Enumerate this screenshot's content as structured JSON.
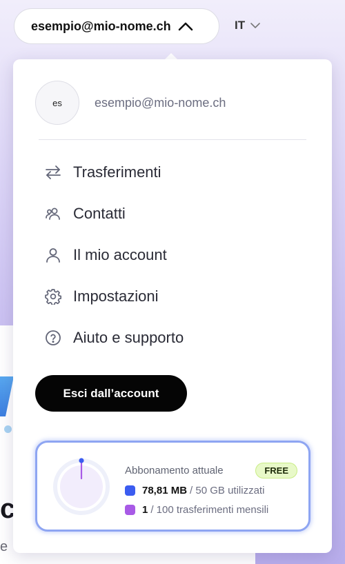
{
  "header": {
    "account_email": "esempio@mio-nome.ch",
    "language": "IT"
  },
  "menu": {
    "avatar_initials": "es",
    "user_email": "esempio@mio-nome.ch",
    "items": [
      {
        "label": "Trasferimenti",
        "icon": "transfer-arrows-icon"
      },
      {
        "label": "Contatti",
        "icon": "contacts-icon"
      },
      {
        "label": "Il mio account",
        "icon": "user-icon"
      },
      {
        "label": "Impostazioni",
        "icon": "gear-icon"
      },
      {
        "label": "Aiuto e supporto",
        "icon": "help-circle-icon"
      }
    ],
    "logout_label": "Esci dall’account"
  },
  "plan": {
    "title": "Abbonamento attuale",
    "badge": "FREE",
    "storage_value": "78,81 MB",
    "storage_rest": "/ 50 GB utilizzati",
    "storage_fraction": 0.0016,
    "transfers_value": "1",
    "transfers_rest": "/ 100 trasferimenti mensili",
    "transfers_fraction": 0.01
  },
  "colors": {
    "storage": "#3b5cf0",
    "transfers": "#a85ae6",
    "accent_border": "#8ea5f2",
    "badge_bg": "#e8f9c8"
  }
}
